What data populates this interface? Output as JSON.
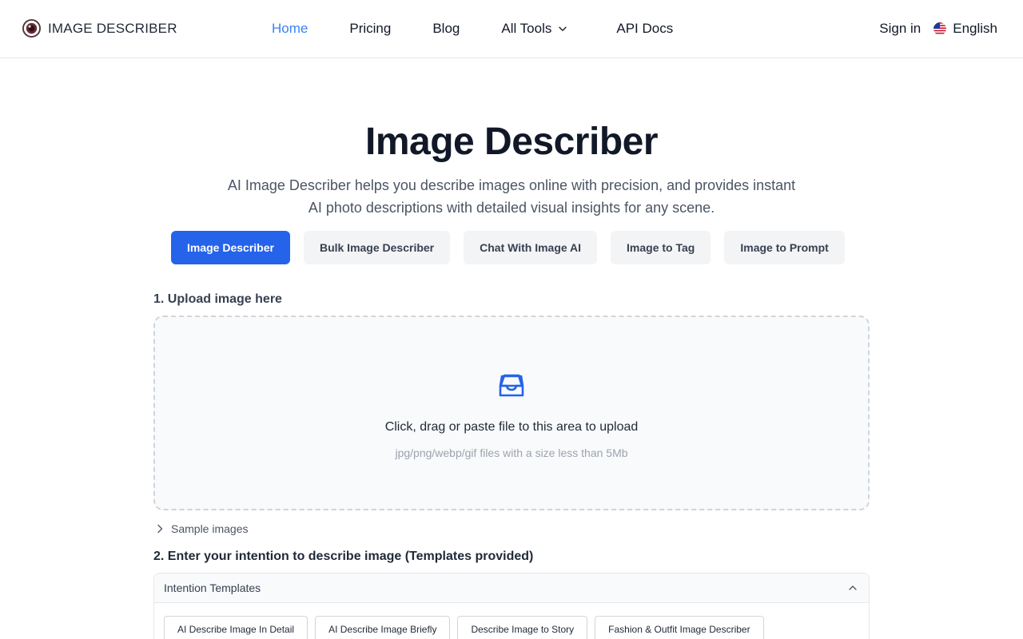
{
  "header": {
    "logo_text": "IMAGE DESCRIBER",
    "nav": [
      {
        "label": "Home"
      },
      {
        "label": "Pricing"
      },
      {
        "label": "Blog"
      },
      {
        "label": "All Tools"
      },
      {
        "label": "API Docs"
      }
    ],
    "signin_label": "Sign in",
    "language_label": "English"
  },
  "hero": {
    "title": "Image Describer",
    "subtitle_line1": "AI Image Describer helps you describe images online with precision, and provides instant",
    "subtitle_line2": "AI photo descriptions with detailed visual insights for any scene."
  },
  "tabs": [
    {
      "label": "Image Describer",
      "active": true
    },
    {
      "label": "Bulk Image Describer"
    },
    {
      "label": "Chat With Image AI"
    },
    {
      "label": "Image to Tag"
    },
    {
      "label": "Image to Prompt"
    }
  ],
  "upload": {
    "step_label": "1. Upload image here",
    "main_text": "Click, drag or paste file to this area to upload",
    "hint_text": "jpg/png/webp/gif files with a size less than 5Mb",
    "samples_label": "Sample images"
  },
  "intention": {
    "step_label": "2. Enter your intention to describe image (Templates provided)",
    "templates_title": "Intention Templates",
    "chips": [
      "AI Describe Image In Detail",
      "AI Describe Image Briefly",
      "Describe Image to Story",
      "Fashion & Outfit Image Describer"
    ]
  },
  "colors": {
    "accent": "#2563eb",
    "nav_active": "#3b82f6"
  }
}
